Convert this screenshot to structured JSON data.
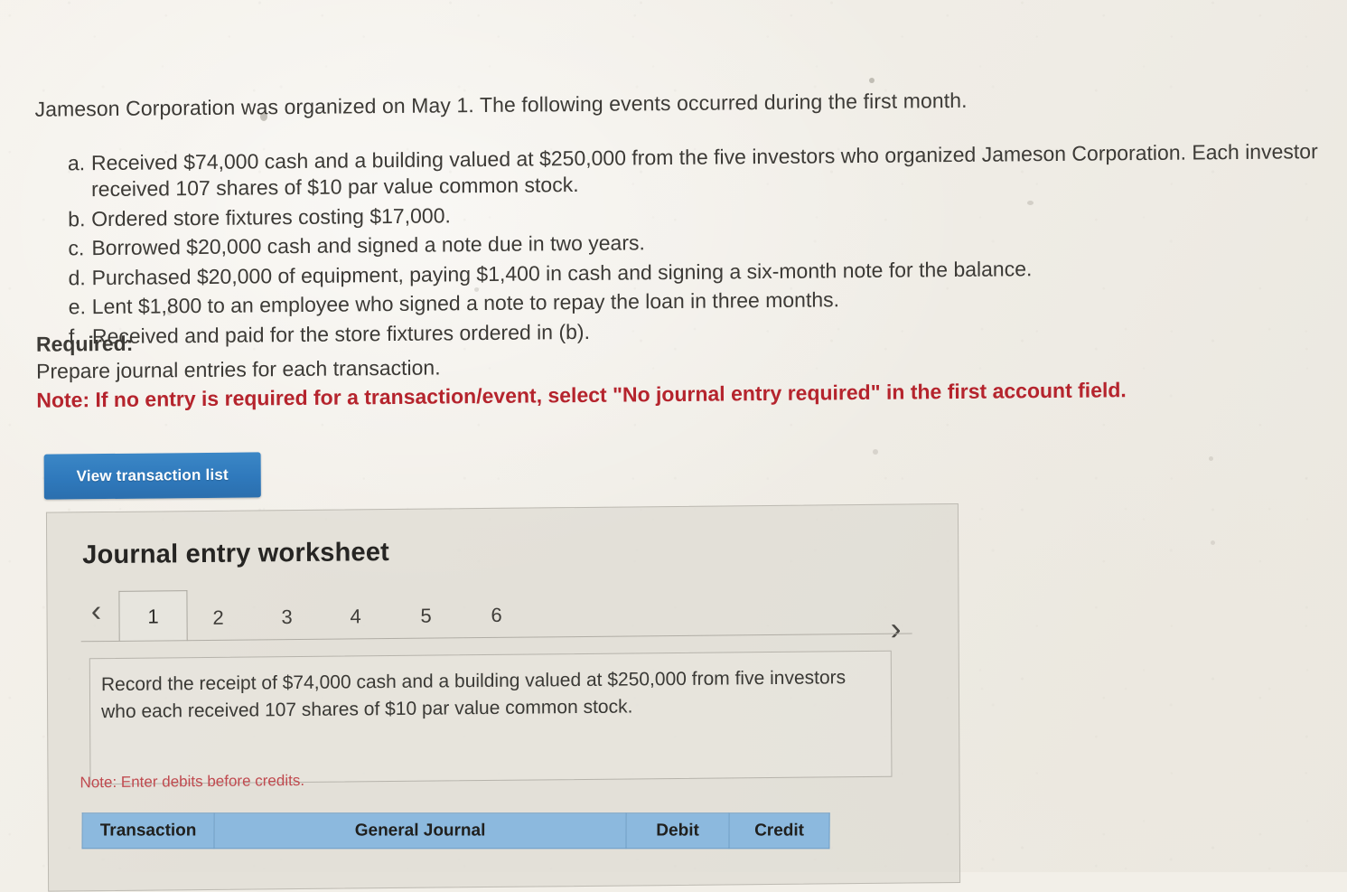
{
  "problem": {
    "intro": "Jameson Corporation was organized on May 1. The following events occurred during the first month.",
    "events": [
      {
        "label": "a.",
        "text": "Received $74,000 cash and a building valued at $250,000 from the five investors who organized Jameson Corporation. Each investor received 107 shares of $10 par value common stock."
      },
      {
        "label": "b.",
        "text": "Ordered store fixtures costing $17,000."
      },
      {
        "label": "c.",
        "text": "Borrowed $20,000 cash and signed a note due in two years."
      },
      {
        "label": "d.",
        "text": "Purchased $20,000 of equipment, paying $1,400 in cash and signing a six-month note for the balance."
      },
      {
        "label": "e.",
        "text": "Lent $1,800 to an employee who signed a note to repay the loan in three months."
      },
      {
        "label": "f.",
        "text": "Received and paid for the store fixtures ordered in (b)."
      }
    ],
    "required_label": "Required:",
    "required_text": "Prepare journal entries for each transaction.",
    "required_note": "Note: If no entry is required for a transaction/event, select \"No journal entry required\" in the first account field."
  },
  "toolbar": {
    "view_transaction_list_label": "View transaction list"
  },
  "worksheet": {
    "title": "Journal entry worksheet",
    "prev_arrow": "‹",
    "next_arrow": "›",
    "tabs": [
      {
        "label": "1",
        "active": true
      },
      {
        "label": "2",
        "active": false
      },
      {
        "label": "3",
        "active": false
      },
      {
        "label": "4",
        "active": false
      },
      {
        "label": "5",
        "active": false
      },
      {
        "label": "6",
        "active": false
      }
    ],
    "transaction_description": "Record the receipt of $74,000 cash and a building valued at $250,000 from five investors who each received 107 shares of $10 par value common stock.",
    "debits_note": "Note: Enter debits before credits.",
    "table": {
      "headers": [
        "Transaction",
        "General Journal",
        "Debit",
        "Credit"
      ]
    }
  },
  "colors": {
    "page_background": "#f2efe8",
    "panel_background": "#dedbd3",
    "button_blue": "#2f79bc",
    "table_header_blue": "#8cb9de",
    "note_red": "#b5242d",
    "debits_note_red": "#c04a4f",
    "body_text": "#3c3a36"
  }
}
